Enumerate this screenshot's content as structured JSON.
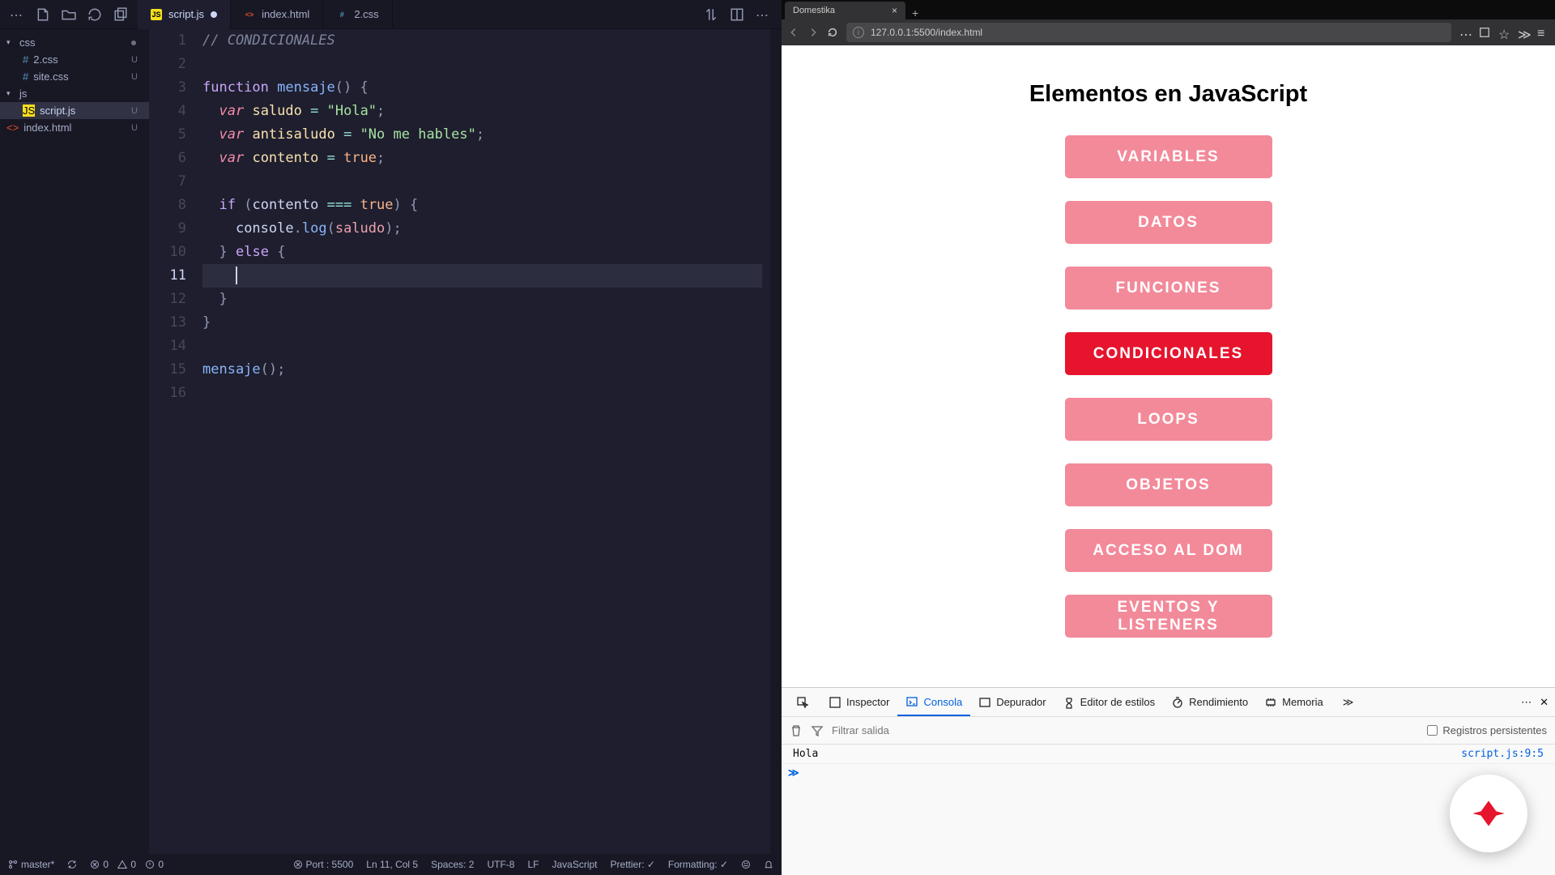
{
  "vscode": {
    "tabs": [
      {
        "icon": "js",
        "label": "script.js",
        "modified": true,
        "active": true
      },
      {
        "icon": "html",
        "label": "index.html",
        "modified": false,
        "active": false
      },
      {
        "icon": "css",
        "label": "2.css",
        "modified": false,
        "active": false
      }
    ],
    "explorer": [
      {
        "type": "folder",
        "label": "css",
        "open": true,
        "modified": true
      },
      {
        "type": "file",
        "icon": "css",
        "label": "2.css",
        "badge": "U",
        "indent": true
      },
      {
        "type": "file",
        "icon": "css",
        "label": "site.css",
        "badge": "U",
        "indent": true
      },
      {
        "type": "folder",
        "label": "js",
        "open": true,
        "modified": false
      },
      {
        "type": "file",
        "icon": "js",
        "label": "script.js",
        "badge": "U",
        "indent": true,
        "selected": true
      },
      {
        "type": "file",
        "icon": "html",
        "label": "index.html",
        "badge": "U"
      }
    ],
    "code": {
      "lines": 16,
      "current_line": 11,
      "comment": "// CONDICIONALES",
      "fn_kw": "function",
      "fn_name": "mensaje",
      "var_kw": "var",
      "v1": "saludo",
      "s1": "\"Hola\"",
      "v2": "antisaludo",
      "s2": "\"No me hables\"",
      "v3": "contento",
      "b1": "true",
      "if_kw": "if",
      "else_kw": "else",
      "cond_var": "contento",
      "cond_op": "===",
      "cond_val": "true",
      "console": "console",
      "log": "log",
      "log_arg": "saludo",
      "call": "mensaje"
    },
    "status": {
      "branch": "master*",
      "errors": "0",
      "warnings": "0",
      "info": "0",
      "port": "Port : 5500",
      "cursor": "Ln 11, Col 5",
      "spaces": "Spaces: 2",
      "encoding": "UTF-8",
      "eol": "LF",
      "lang": "JavaScript",
      "prettier": "Prettier: ✓",
      "formatting": "Formatting: ✓"
    }
  },
  "browser": {
    "tab_title": "Domestika",
    "url": "127.0.0.1:5500/index.html",
    "page_title": "Elementos en JavaScript",
    "buttons": [
      {
        "label": "VARIABLES",
        "active": false
      },
      {
        "label": "DATOS",
        "active": false
      },
      {
        "label": "FUNCIONES",
        "active": false
      },
      {
        "label": "CONDICIONALES",
        "active": true
      },
      {
        "label": "LOOPS",
        "active": false
      },
      {
        "label": "OBJETOS",
        "active": false
      },
      {
        "label": "ACCESO AL DOM",
        "active": false
      },
      {
        "label": "EVENTOS Y LISTENERS",
        "active": false
      }
    ]
  },
  "devtools": {
    "tabs": [
      "Inspector",
      "Consola",
      "Depurador",
      "Editor de estilos",
      "Rendimiento",
      "Memoria"
    ],
    "active_tab": "Consola",
    "filter_placeholder": "Filtrar salida",
    "persist_label": "Registros persistentes",
    "log_msg": "Hola",
    "log_src": "script.js:9:5",
    "prompt": "≫"
  }
}
